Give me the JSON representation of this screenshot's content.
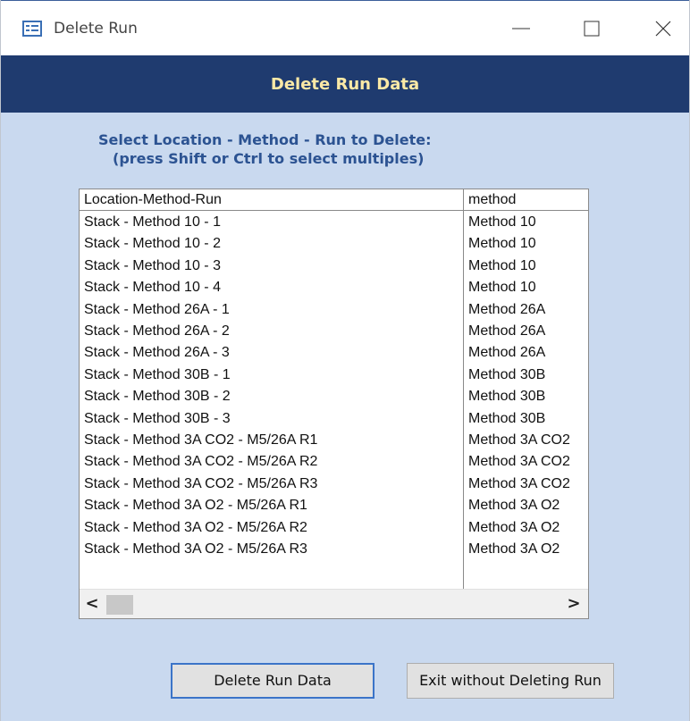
{
  "window": {
    "title": "Delete Run",
    "app_icon": "form-icon",
    "controls": [
      "minimize-icon",
      "maximize-icon",
      "close-icon"
    ]
  },
  "header": {
    "title": "Delete Run Data"
  },
  "instructions": {
    "line1": "Select Location - Method - Run to Delete:",
    "line2": "(press Shift or Ctrl to select multiples)"
  },
  "list": {
    "columns": [
      "Location-Method-Run",
      "method"
    ],
    "rows": [
      [
        "Stack - Method 10 - 1",
        "Method 10"
      ],
      [
        "Stack - Method 10 - 2",
        "Method 10"
      ],
      [
        "Stack - Method 10 - 3",
        "Method 10"
      ],
      [
        "Stack - Method 10 - 4",
        "Method 10"
      ],
      [
        "Stack - Method 26A - 1",
        "Method 26A"
      ],
      [
        "Stack - Method 26A - 2",
        "Method 26A"
      ],
      [
        "Stack - Method 26A - 3",
        "Method 26A"
      ],
      [
        "Stack - Method 30B - 1",
        "Method 30B"
      ],
      [
        "Stack - Method 30B - 2",
        "Method 30B"
      ],
      [
        "Stack - Method 30B - 3",
        "Method 30B"
      ],
      [
        "Stack - Method 3A CO2 - M5/26A R1",
        "Method 3A CO2"
      ],
      [
        "Stack - Method 3A CO2 - M5/26A R2",
        "Method 3A CO2"
      ],
      [
        "Stack - Method 3A CO2 - M5/26A R3",
        "Method 3A CO2"
      ],
      [
        "Stack - Method 3A O2 - M5/26A R1",
        "Method 3A O2"
      ],
      [
        "Stack - Method 3A O2 - M5/26A R2",
        "Method 3A O2"
      ],
      [
        "Stack - Method 3A O2 - M5/26A R3",
        "Method 3A O2"
      ]
    ],
    "scroll_left": "<",
    "scroll_right": ">"
  },
  "buttons": {
    "delete_label": "Delete Run Data",
    "exit_label": "Exit without Deleting Run"
  },
  "colors": {
    "header_band": "#1f3b6f",
    "header_text": "#fbe9a6",
    "form_background": "#c9d9ef",
    "instruction_text": "#2c5392"
  }
}
